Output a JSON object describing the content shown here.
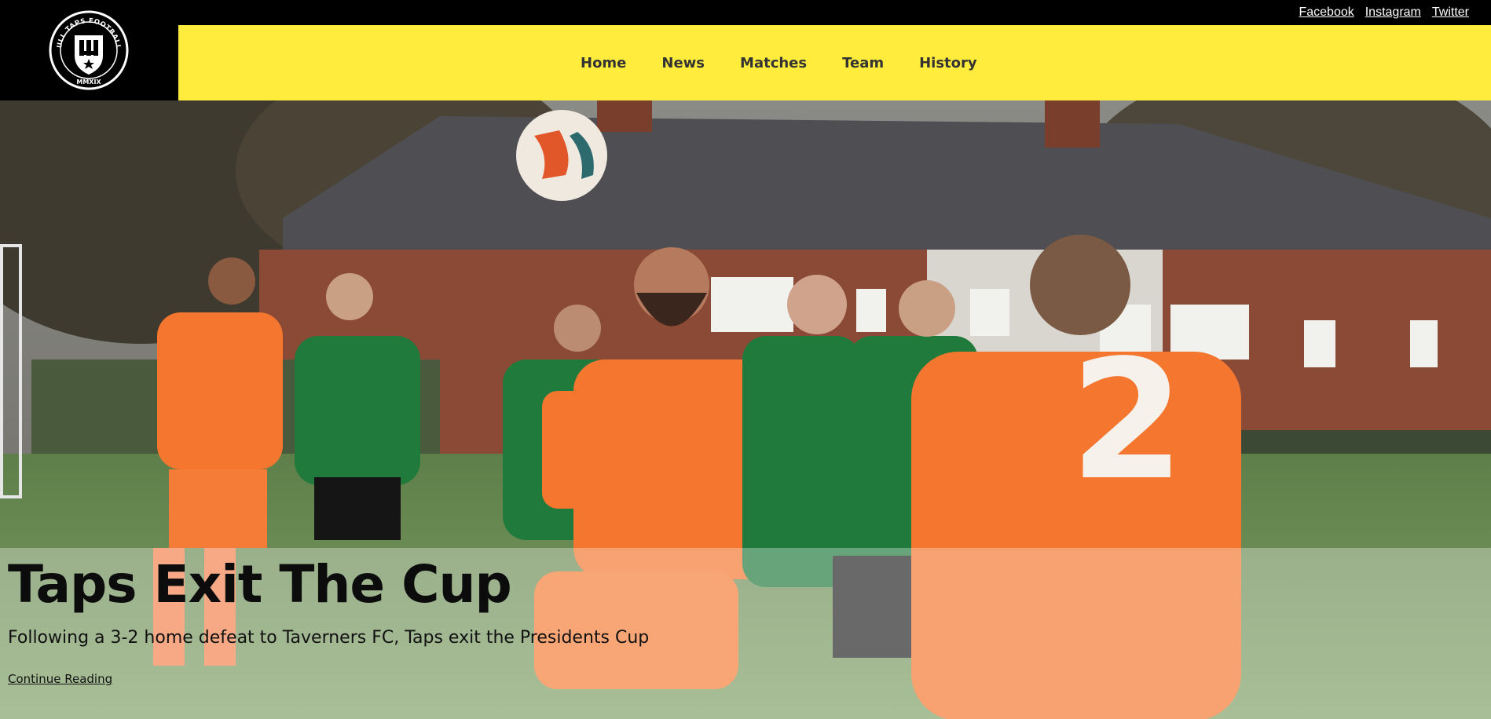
{
  "brand": {
    "name": "SOLIHULL TAPS FOOTBALL CLUB",
    "year": "MMXIX"
  },
  "social": {
    "facebook": "Facebook",
    "instagram": "Instagram",
    "twitter": "Twitter"
  },
  "nav": {
    "items": [
      "Home",
      "News",
      "Matches",
      "Team",
      "History"
    ]
  },
  "hero": {
    "title": "Taps Exit The Cup",
    "subtitle": "Following a 3-2 home defeat to Taverners FC, Taps exit the Presidents Cup",
    "link": "Continue Reading"
  },
  "colors": {
    "nav_bg": "#ffec3d",
    "header_bg": "#000000",
    "kit_home": "#f5772f",
    "kit_away": "#1f7a3c"
  }
}
